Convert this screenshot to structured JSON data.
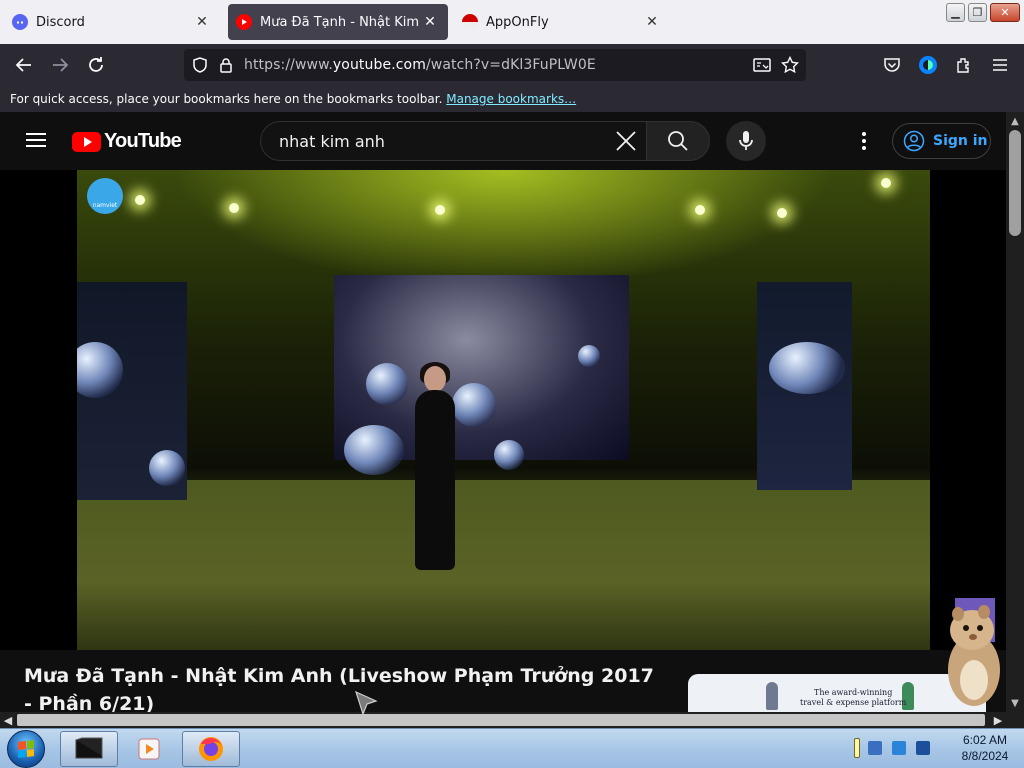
{
  "browser": {
    "tabs": [
      {
        "label": "Discord",
        "favicon": "discord-icon"
      },
      {
        "label": "Mưa Đã Tạnh - Nhật Kim Anh (Liveshow",
        "favicon": "youtube-icon"
      },
      {
        "label": "AppOnFly",
        "favicon": "apponfly-icon"
      }
    ],
    "url_prefix": "https://www.",
    "url_domain": "youtube.com",
    "url_path": "/watch?v=dKl3FuPLW0E",
    "bookmarks_text": "For quick access, place your bookmarks here on the bookmarks toolbar.",
    "bookmarks_link": "Manage bookmarks…",
    "icons": [
      "back-icon",
      "forward-icon",
      "reload-icon",
      "shield-icon",
      "lock-icon",
      "reader-view-icon",
      "star-icon",
      "pocket-icon",
      "account-icon",
      "extensions-icon",
      "menu-icon"
    ]
  },
  "youtube": {
    "logo_text": "YouTube",
    "search_value": "nhat kim anh",
    "signin_label": "Sign in",
    "video_title": "Mưa Đã Tạnh - Nhật Kim Anh (Liveshow Phạm Trưởng 2017 - Phần 6/21)",
    "watermark": "namviet",
    "ad_text_line1": "The award-winning",
    "ad_text_line2": "travel & expense platform"
  },
  "taskbar": {
    "time": "6:02 AM",
    "date": "8/8/2024"
  },
  "colors": {
    "accent_link": "#3ea6ff",
    "youtube_red": "#ff0000",
    "firefox_dark": "#2b2a33"
  }
}
